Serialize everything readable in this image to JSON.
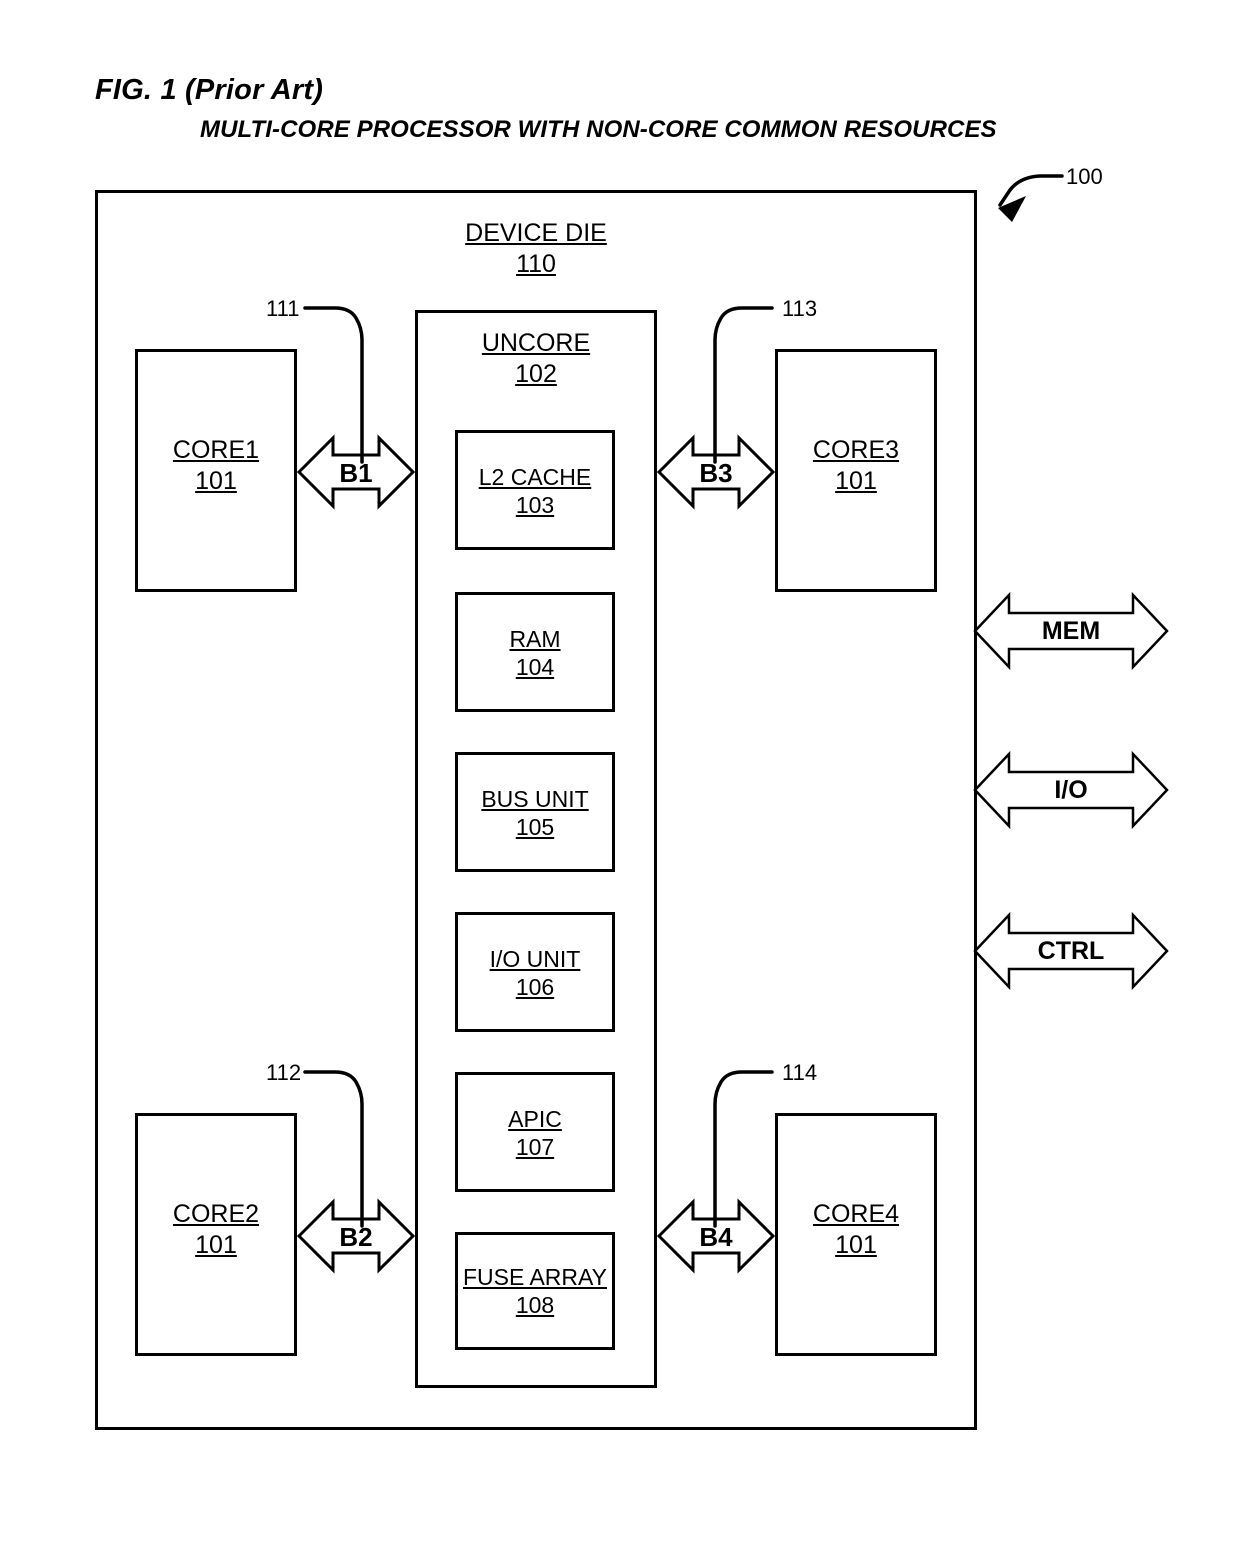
{
  "figure": {
    "label": "FIG. 1 (Prior Art)",
    "subtitle": "MULTI-CORE PROCESSOR WITH NON-CORE COMMON RESOURCES",
    "system_ref": "100"
  },
  "device_die": {
    "title": "DEVICE DIE",
    "ref": "110"
  },
  "uncore": {
    "title": "UNCORE",
    "ref": "102",
    "blocks": [
      {
        "title": "L2 CACHE",
        "ref": "103"
      },
      {
        "title": "RAM",
        "ref": "104"
      },
      {
        "title": "BUS UNIT",
        "ref": "105"
      },
      {
        "title": "I/O UNIT",
        "ref": "106"
      },
      {
        "title": "APIC",
        "ref": "107"
      },
      {
        "title": "FUSE ARRAY",
        "ref": "108"
      }
    ]
  },
  "cores": [
    {
      "title": "CORE1",
      "ref": "101"
    },
    {
      "title": "CORE3",
      "ref": "101"
    },
    {
      "title": "CORE2",
      "ref": "101"
    },
    {
      "title": "CORE4",
      "ref": "101"
    }
  ],
  "buses": [
    {
      "label": "B1",
      "ref": "111"
    },
    {
      "label": "B3",
      "ref": "113"
    },
    {
      "label": "B2",
      "ref": "112"
    },
    {
      "label": "B4",
      "ref": "114"
    }
  ],
  "external_interfaces": [
    {
      "label": "MEM"
    },
    {
      "label": "I/O"
    },
    {
      "label": "CTRL"
    }
  ],
  "colors": {
    "line": "#000000",
    "background": "#ffffff"
  }
}
